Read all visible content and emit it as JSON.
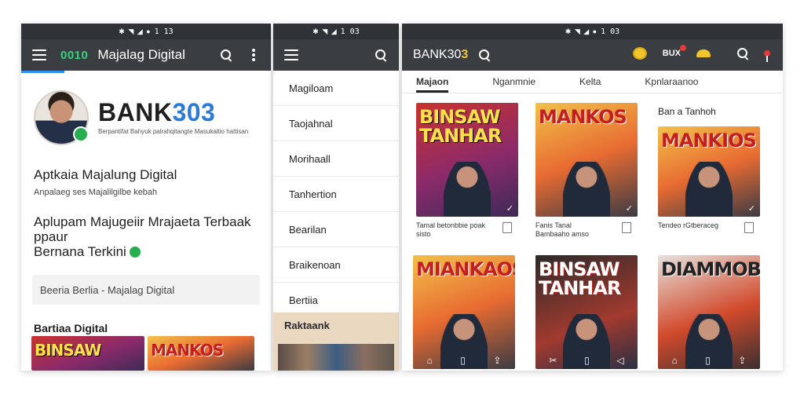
{
  "screen1": {
    "status_time": "1 13",
    "brand_badge": "0010",
    "app_title": "Majalag Digital",
    "brand_name_a": "BANK",
    "brand_name_b": "303",
    "brand_sub": "Berpantifat Bahyuk palrahqitangte Masukaitio hattisan",
    "heading": "Aptkaia Majalung Digital",
    "subheading": "Anpalaeg ses Majalilgilbe kebah",
    "big_line1": "Aplupam Majugeiir Mrajaeta Terbaak",
    "big_line2": "ppaur",
    "big_line3": "Bernana Terkini",
    "field_text": "Beeria Berlia - Majalag Digital",
    "section_title": "Bartiaa Digital",
    "thumb1": "BINSAW",
    "thumb2": "MANKOS"
  },
  "screen2": {
    "status_time": "1 03",
    "menu": [
      "Magiloam",
      "Taojahnal",
      "Morihaall",
      "Tanhertion",
      "Bearilan",
      "Braikenoan",
      "Bertiia"
    ],
    "footer_label": "Raktaank"
  },
  "screen3": {
    "status_time": "1 03",
    "app_title_a": "BANK30",
    "app_title_b": "3",
    "bux_label": "BUX",
    "tabs": [
      "Majaon",
      "Nganmnie",
      "Kelta",
      "Kpnlaraanoo"
    ],
    "cards": [
      {
        "title": "BINSAW TANHAR",
        "caption": "Tamal betonbbie poak sisto"
      },
      {
        "title": "MANKOS",
        "caption": "Fanis Tanal Bambaaho amso"
      },
      {
        "title": "MANKIOS",
        "caption": "Tendeo rGtberaceg"
      },
      {
        "title": "MIANKAOS",
        "caption": ""
      },
      {
        "title": "BINSAW TANHAR",
        "caption": ""
      },
      {
        "title": "DIAMMOBOS",
        "caption": ""
      }
    ],
    "cta": "Ban a Tanhoh"
  }
}
